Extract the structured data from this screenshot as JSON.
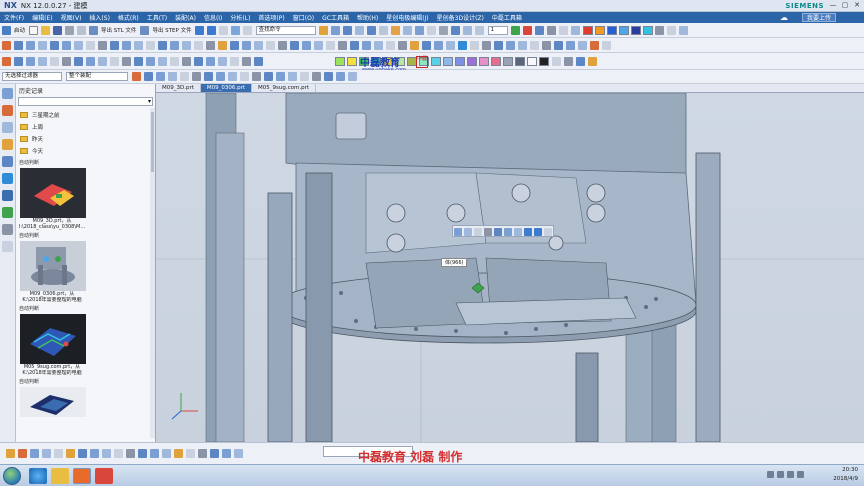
{
  "window": {
    "logo": "NX",
    "title": "NX 12.0.0.27 - 建模",
    "brand": "SIEMENS",
    "controls": [
      "—",
      "▢",
      "✕"
    ]
  },
  "menubar": {
    "items": [
      "文件(F)",
      "编辑(E)",
      "视图(V)",
      "插入(S)",
      "格式(R)",
      "工具(T)",
      "装配(A)",
      "信息(I)",
      "分析(L)",
      "首选项(P)",
      "窗口(O)",
      "GC工具箱",
      "帮助(H)",
      "星创电极编辑(J)",
      "星创备3D设计(Z)",
      "中磊工具箱"
    ],
    "upload_button": "我要上传"
  },
  "toolbar": {
    "start_label": "启动",
    "stl_label": "导出 STL 文件",
    "step_label": "导出 STEP 文件",
    "search_placeholder": "查找命令",
    "filter_value": "无选择过滤器",
    "assembly_value": "整个装配"
  },
  "watermark": {
    "brand": "中磊教育",
    "url": "www.ugbake.com",
    "seal": "中磊"
  },
  "history": {
    "title": "历史记录",
    "folders": [
      "三星期之前",
      "上周",
      "昨天",
      "今天"
    ],
    "section_label": "自动判断",
    "items": [
      {
        "section": "自动判断",
        "name": "M09_3D.prt，从",
        "path": "I:\\2018_class\\yu_0308\\M..."
      },
      {
        "section": "自动判断",
        "name": "M09_0306.prt，从",
        "path": "K:\\2018年需要整理的电脑"
      },
      {
        "section": "自动判断",
        "name": "M05_9sug.com.prt，从",
        "path": "K:\\2018年需要整理的电脑"
      },
      {
        "section": "自动判断",
        "name": "",
        "path": ""
      }
    ]
  },
  "tabs": [
    {
      "label": "M09_3D.prt",
      "active": false
    },
    {
      "label": "M09_0306.prt",
      "active": true
    },
    {
      "label": "M05_9sug.com.prt",
      "active": false
    }
  ],
  "viewport": {
    "tooltip": "体(966)"
  },
  "credit": "中磊教育  刘磊  制作",
  "taskbar": {
    "time": "20:30",
    "date": "2018/4/9"
  },
  "colors": {
    "menubar": "#2b65a8",
    "active_tab": "#3a6db0",
    "model_steel": "#8fa3b8",
    "credit_red": "#d32f2f",
    "watermark_blue": "#1f3fb0"
  }
}
